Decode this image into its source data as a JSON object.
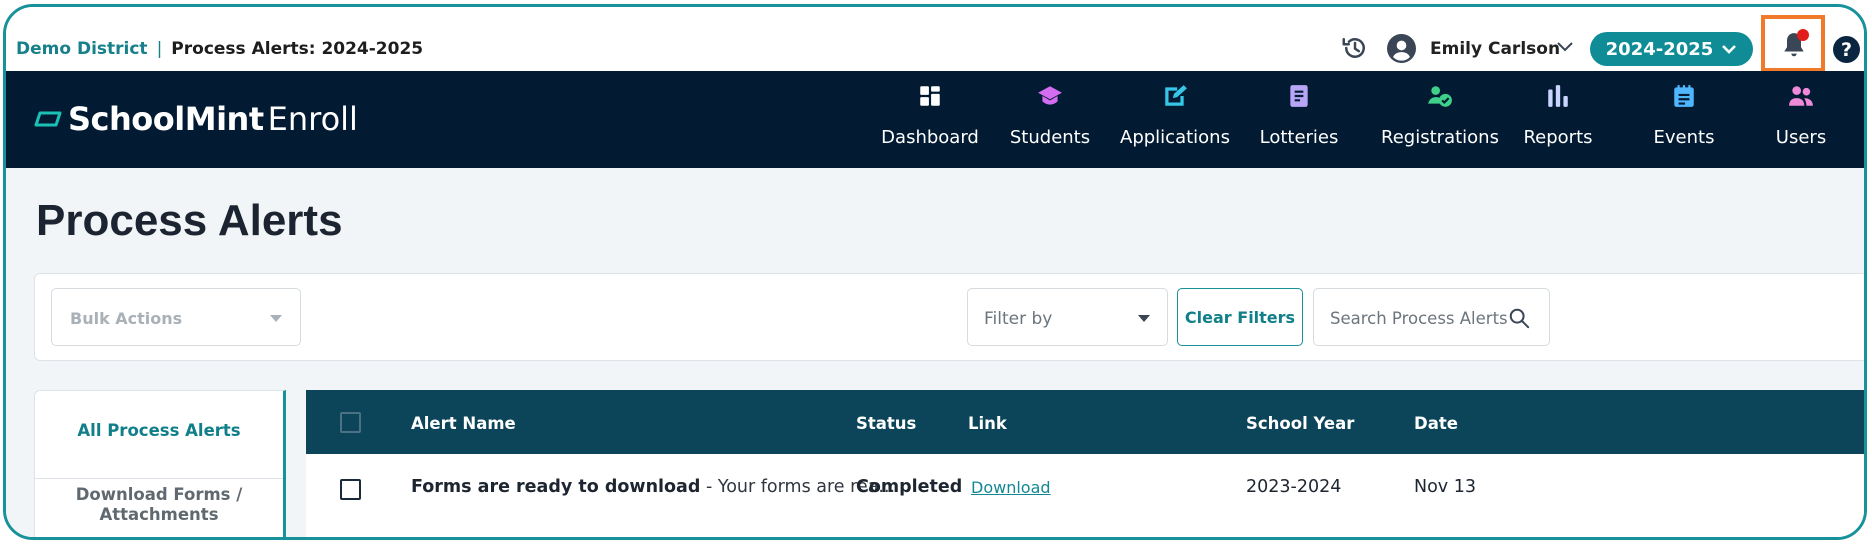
{
  "header": {
    "district": "Demo District",
    "separator": "|",
    "page_context": "Process Alerts: 2024-2025",
    "user_name": "Emily Carlson",
    "school_year_selector": "2024-2025",
    "help": "?"
  },
  "brand": {
    "name_bold": "SchoolMint",
    "name_light": "Enroll"
  },
  "nav": {
    "items": [
      {
        "label": "Dashboard",
        "icon": "dashboard-icon",
        "color": "#ffffff"
      },
      {
        "label": "Students",
        "icon": "graduation-cap-icon",
        "color": "#d46cf2"
      },
      {
        "label": "Applications",
        "icon": "edit-document-icon",
        "color": "#38c6e8"
      },
      {
        "label": "Lotteries",
        "icon": "clipboard-icon",
        "color": "#b7a6f5"
      },
      {
        "label": "Registrations",
        "icon": "user-check-icon",
        "color": "#3fd08a"
      },
      {
        "label": "Reports",
        "icon": "bar-chart-icon",
        "color": "#c9d5ff"
      },
      {
        "label": "Events",
        "icon": "calendar-notes-icon",
        "color": "#4fb7ff"
      },
      {
        "label": "Users",
        "icon": "users-icon",
        "color": "#f08ad8"
      }
    ]
  },
  "page": {
    "title": "Process Alerts"
  },
  "toolbar": {
    "bulk_actions": "Bulk Actions",
    "filter_by": "Filter by",
    "clear_filters": "Clear Filters",
    "search_placeholder": "Search Process Alerts"
  },
  "sidebar": {
    "items": [
      {
        "label": "All Process Alerts",
        "active": true
      },
      {
        "label": "Download Forms / Attachments",
        "active": false
      }
    ]
  },
  "table": {
    "columns": [
      "Alert Name",
      "Status",
      "Link",
      "School Year",
      "Date"
    ],
    "rows": [
      {
        "alert_name": "Forms are ready to download",
        "alert_desc": " - Your forms are rea...",
        "status": "Completed",
        "link": "Download",
        "school_year": "2023-2024",
        "date": "Nov 13"
      }
    ]
  },
  "colors": {
    "accent": "#17919a",
    "nav_bg": "#021b33",
    "table_header_bg": "#0c4559",
    "notification_highlight": "#f07a2a",
    "notification_dot": "#e21b1b"
  }
}
